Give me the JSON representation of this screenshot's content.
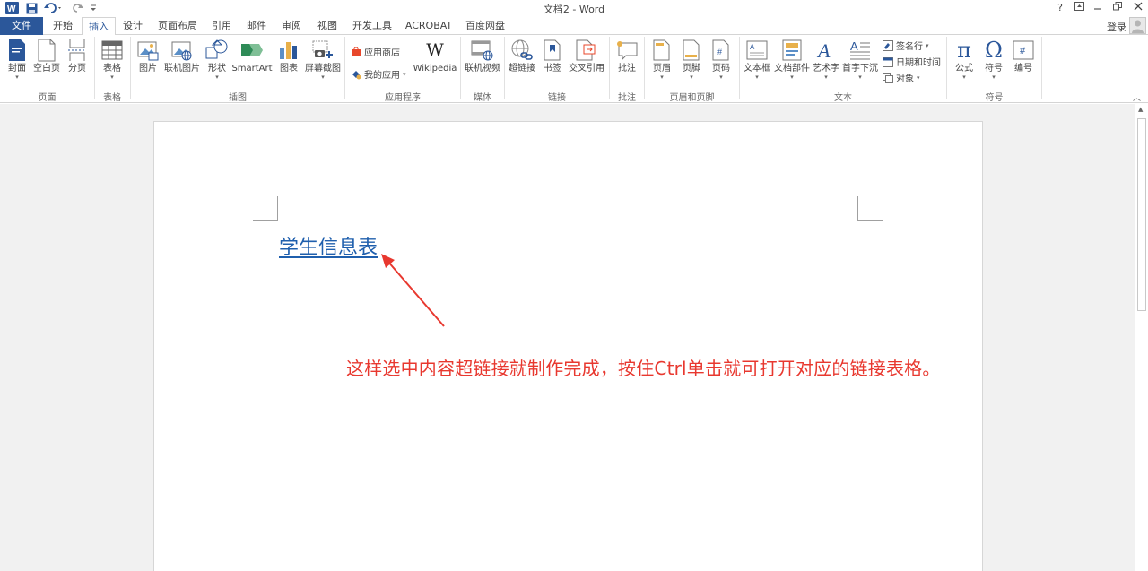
{
  "window": {
    "title": "文档2 - Word",
    "help": "?",
    "buttons": [
      "ribbon-display",
      "minimize",
      "restore",
      "close"
    ]
  },
  "quick_access": {
    "icons": [
      "word-logo-icon",
      "save-icon",
      "undo-icon",
      "redo-icon",
      "customize-icon"
    ]
  },
  "tabs": [
    {
      "label": "文件"
    },
    {
      "label": "开始"
    },
    {
      "label": "插入"
    },
    {
      "label": "设计"
    },
    {
      "label": "页面布局"
    },
    {
      "label": "引用"
    },
    {
      "label": "邮件"
    },
    {
      "label": "审阅"
    },
    {
      "label": "视图"
    },
    {
      "label": "开发工具"
    },
    {
      "label": "ACROBAT"
    },
    {
      "label": "百度网盘"
    }
  ],
  "active_tab": "插入",
  "account": {
    "login_label": "登录"
  },
  "ribbon": {
    "groups": {
      "pages": "页面",
      "tables": "表格",
      "illustrations": "插图",
      "apps": "应用程序",
      "media": "媒体",
      "links": "链接",
      "comments": "批注",
      "header_footer": "页眉和页脚",
      "text": "文本",
      "symbols": "符号"
    },
    "buttons": {
      "cover": "封面",
      "blank_page": "空白页",
      "page_break": "分页",
      "table": "表格",
      "picture": "图片",
      "online_picture": "联机图片",
      "shapes": "形状",
      "smartart": "SmartArt",
      "chart": "图表",
      "screenshot": "屏幕截图",
      "app_store": "应用商店",
      "my_apps": "我的应用",
      "wikipedia": "Wikipedia",
      "online_video": "联机视频",
      "hyperlink": "超链接",
      "bookmark": "书签",
      "cross_ref": "交叉引用",
      "comment": "批注",
      "header": "页眉",
      "footer": "页脚",
      "page_number": "页码",
      "text_box": "文本框",
      "quick_parts": "文档部件",
      "wordart": "艺术字",
      "drop_cap": "首字下沉",
      "signature_line": "签名行",
      "date_time": "日期和时间",
      "object": "对象",
      "equation": "公式",
      "symbol": "符号",
      "number": "编号"
    }
  },
  "document": {
    "heading_link": "学生信息表"
  },
  "annotation": "这样选中内容超链接就制作完成，按住Ctrl单击就可打开对应的链接表格。",
  "colors": {
    "file_tab": "#2b579a",
    "hyperlink": "#1f5fad",
    "annotation": "#e8382f"
  }
}
